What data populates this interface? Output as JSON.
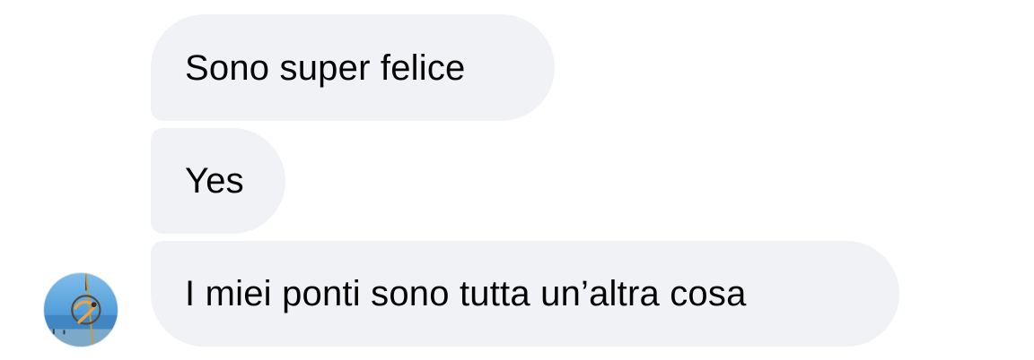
{
  "messages": [
    {
      "text": "Sono super felice"
    },
    {
      "text": "Yes"
    },
    {
      "text": "I miei ponti sono tutta un’altra cosa"
    }
  ],
  "colors": {
    "bubble_bg": "#f1f2f6",
    "text": "#050505",
    "avatar_sky": "#5aa6df",
    "avatar_sea": "#3f86c2"
  },
  "avatar": {
    "icon": "aerial-hoop-photo-icon"
  }
}
